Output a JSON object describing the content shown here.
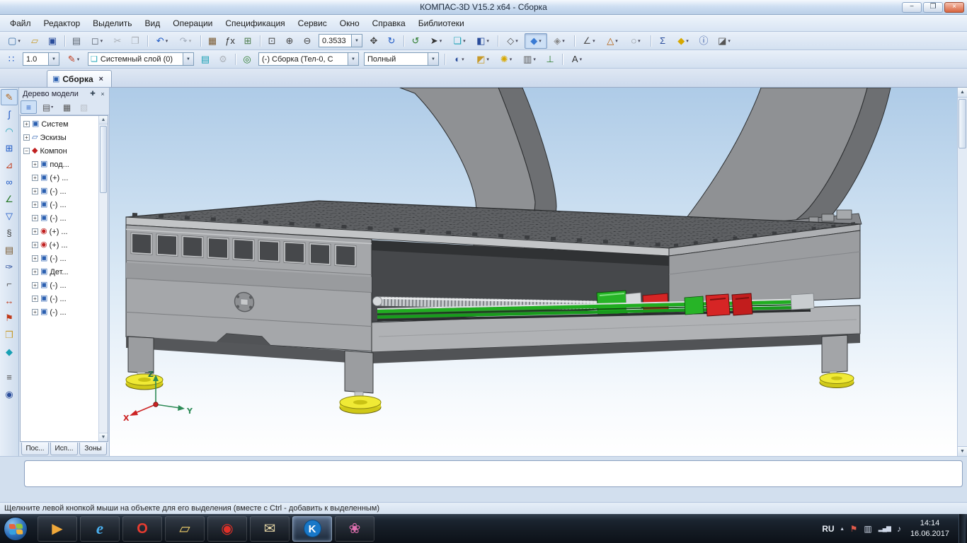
{
  "window": {
    "title": "КОМПАС-3D V15.2 x64 - Сборка",
    "minimize": "−",
    "restore": "❐",
    "close": "×"
  },
  "menu": {
    "items": [
      {
        "name": "menu-file",
        "label": "Файл"
      },
      {
        "name": "menu-editor",
        "label": "Редактор"
      },
      {
        "name": "menu-select",
        "label": "Выделить"
      },
      {
        "name": "menu-view",
        "label": "Вид"
      },
      {
        "name": "menu-operations",
        "label": "Операции"
      },
      {
        "name": "menu-specification",
        "label": "Спецификация"
      },
      {
        "name": "menu-service",
        "label": "Сервис"
      },
      {
        "name": "menu-window",
        "label": "Окно"
      },
      {
        "name": "menu-help",
        "label": "Справка"
      },
      {
        "name": "menu-libraries",
        "label": "Библиотеки"
      }
    ]
  },
  "toolbar1": {
    "zoom": {
      "value": "0.3533"
    },
    "buttons_a": [
      {
        "name": "new-document-button",
        "icon": "new-document-icon",
        "glyph": "▢",
        "color": "#3a6ea5",
        "cls": "dd"
      },
      {
        "name": "open-button",
        "icon": "open-folder-icon",
        "glyph": "▱",
        "color": "#c79a2a",
        "cls": ""
      },
      {
        "name": "save-button",
        "icon": "save-icon",
        "glyph": "▣",
        "color": "#2a4d9b",
        "cls": ""
      },
      {
        "name": "print-button",
        "icon": "printer-icon",
        "glyph": "▤",
        "color": "#5a6470",
        "cls": "sep"
      },
      {
        "name": "preview-button",
        "icon": "preview-icon",
        "glyph": "◻",
        "color": "#5a6470",
        "cls": "dd"
      },
      {
        "name": "cut-button",
        "icon": "scissors-icon",
        "glyph": "✂",
        "color": "#555555",
        "cls": "disabled"
      },
      {
        "name": "copy-button",
        "icon": "copy-icon",
        "glyph": "❐",
        "color": "#555555",
        "cls": "disabled"
      },
      {
        "name": "undo-button",
        "icon": "undo-icon",
        "glyph": "↶",
        "color": "#1a56c4",
        "cls": "sep dd"
      },
      {
        "name": "redo-button",
        "icon": "redo-icon",
        "glyph": "↷",
        "color": "#1a56c4",
        "cls": "dd disabled"
      },
      {
        "name": "library-manager-button",
        "icon": "library-icon",
        "glyph": "▦",
        "color": "#7a5a30",
        "cls": "sep"
      },
      {
        "name": "variables-button",
        "icon": "fx-icon",
        "glyph": "ƒx",
        "color": "#333333",
        "cls": ""
      },
      {
        "name": "spreadsheet-button",
        "icon": "table-icon",
        "glyph": "⊞",
        "color": "#4a7a4a",
        "cls": ""
      },
      {
        "name": "zoom-area-button",
        "icon": "zoom-area-icon",
        "glyph": "⊡",
        "color": "#444444",
        "cls": "sep"
      },
      {
        "name": "zoom-in-button",
        "icon": "zoom-in-icon",
        "glyph": "⊕",
        "color": "#444444",
        "cls": ""
      },
      {
        "name": "zoom-out-button",
        "icon": "zoom-out-icon",
        "glyph": "⊖",
        "color": "#444444",
        "cls": ""
      }
    ],
    "buttons_b": [
      {
        "name": "pan-button",
        "icon": "pan-icon",
        "glyph": "✥",
        "color": "#444444",
        "cls": ""
      },
      {
        "name": "rotate-button",
        "icon": "orbit-icon",
        "glyph": "↻",
        "color": "#1a56c4",
        "cls": ""
      },
      {
        "name": "refresh-button",
        "icon": "refresh-icon",
        "glyph": "↺",
        "color": "#2a7a2a",
        "cls": "sep"
      },
      {
        "name": "selection-filter-button",
        "icon": "cursor-icon",
        "glyph": "➤",
        "color": "#333333",
        "cls": "dd"
      },
      {
        "name": "layers-button",
        "icon": "layers-icon",
        "glyph": "❏",
        "color": "#18a0b4",
        "cls": "dd"
      },
      {
        "name": "orientation-button",
        "icon": "orientation-cube-icon",
        "glyph": "◧",
        "color": "#2a4d9b",
        "cls": "dd"
      },
      {
        "name": "wireframe-button",
        "icon": "wireframe-cube-icon",
        "glyph": "◇",
        "color": "#555555",
        "cls": "sep dd"
      },
      {
        "name": "shaded-button",
        "icon": "shaded-cube-icon",
        "glyph": "◆",
        "color": "#3a7bd4",
        "cls": "dd active"
      },
      {
        "name": "simplified-button",
        "icon": "simplified-cube-icon",
        "glyph": "◈",
        "color": "#888888",
        "cls": "dd"
      },
      {
        "name": "measure-button",
        "icon": "measure-icon",
        "glyph": "∠",
        "color": "#555555",
        "cls": "sep dd"
      },
      {
        "name": "check-collisions-button",
        "icon": "collision-icon",
        "glyph": "△",
        "color": "#b35900",
        "cls": "dd"
      },
      {
        "name": "hide-components-button",
        "icon": "hide-icon",
        "glyph": "◌",
        "color": "#555555",
        "cls": "dd"
      },
      {
        "name": "mass-properties-button",
        "icon": "scales-icon",
        "glyph": "Σ",
        "color": "#2a4d9b",
        "cls": "sep"
      },
      {
        "name": "component-button",
        "icon": "component-cube-icon",
        "glyph": "◆",
        "color": "#d7a800",
        "cls": "dd"
      },
      {
        "name": "info-button",
        "icon": "info-icon",
        "glyph": "ⓘ",
        "color": "#2a4d9b",
        "cls": ""
      },
      {
        "name": "section-view-button",
        "icon": "section-icon",
        "glyph": "◪",
        "color": "#555555",
        "cls": "dd"
      }
    ]
  },
  "toolbar2": {
    "line_width": "1.0",
    "layer": "Системный слой (0)",
    "layer_icon": "❏",
    "assembly": "(-) Сборка (Тел-0, С",
    "display_mode": "Полный",
    "g1": [
      {
        "name": "snap-button",
        "icon": "grid-snap-icon",
        "glyph": "∷",
        "color": "#1a56c4",
        "cls": ""
      }
    ],
    "g2": [
      {
        "name": "line-style-button",
        "icon": "pencil-icon",
        "glyph": "✎",
        "color": "#c03a1a",
        "cls": "dd"
      }
    ],
    "g3": [
      {
        "name": "layers-manager-button",
        "icon": "layers-manager-icon",
        "glyph": "▤",
        "color": "#18a0b4",
        "cls": ""
      },
      {
        "name": "layer-settings-button",
        "icon": "gear-icon",
        "glyph": "⚙",
        "color": "#666666",
        "cls": "disabled"
      }
    ],
    "g4": [
      {
        "name": "edit-scope-button",
        "icon": "scope-icon",
        "glyph": "◎",
        "color": "#2a7a2a",
        "cls": "sep"
      }
    ],
    "g5": [
      {
        "name": "appearance-button",
        "icon": "sphere-icon",
        "glyph": "◐",
        "color": "#2a4d9b",
        "cls": "sep dd"
      },
      {
        "name": "perspective-button",
        "icon": "perspective-icon",
        "glyph": "◩",
        "color": "#c79a2a",
        "cls": "dd"
      },
      {
        "name": "lights-button",
        "icon": "light-icon",
        "glyph": "✺",
        "color": "#d7a800",
        "cls": "dd"
      },
      {
        "name": "clip-plane-button",
        "icon": "clip-plane-icon",
        "glyph": "▥",
        "color": "#555555",
        "cls": "dd"
      },
      {
        "name": "origin-axes-button",
        "icon": "axes-icon",
        "glyph": "⊥",
        "color": "#2a7a2a",
        "cls": ""
      },
      {
        "name": "spell-check-button",
        "icon": "spellcheck-icon",
        "glyph": "А",
        "color": "#333333",
        "cls": "sep dd"
      }
    ]
  },
  "doc_tab": {
    "icon": "▣",
    "label": "Сборка",
    "close": "×"
  },
  "compact_panel": {
    "items": [
      {
        "name": "edit-assembly-panel-button",
        "icon": "pencil-cube-icon",
        "glyph": "✎",
        "color": "#b3651a",
        "cls": "active"
      },
      {
        "name": "spatial-curves-panel-button",
        "icon": "curve-icon",
        "glyph": "∫",
        "color": "#1a56c4",
        "cls": ""
      },
      {
        "name": "surfaces-panel-button",
        "icon": "surface-icon",
        "glyph": "◠",
        "color": "#18a0b4",
        "cls": ""
      },
      {
        "name": "arrays-panel-button",
        "icon": "array-icon",
        "glyph": "⊞",
        "color": "#1a56c4",
        "cls": ""
      },
      {
        "name": "aux-geometry-panel-button",
        "icon": "aux-geometry-icon",
        "glyph": "⊿",
        "color": "#c03a1a",
        "cls": ""
      },
      {
        "name": "mates-panel-button",
        "icon": "mate-icon",
        "glyph": "∞",
        "color": "#1a56c4",
        "cls": ""
      },
      {
        "name": "measure3d-panel-button",
        "icon": "angle-icon",
        "glyph": "∠",
        "color": "#2a7a2a",
        "cls": ""
      },
      {
        "name": "filters-panel-button",
        "icon": "filter-icon",
        "glyph": "▽",
        "color": "#1a56c4",
        "cls": ""
      },
      {
        "name": "specification-panel-button",
        "icon": "spec-icon",
        "glyph": "§",
        "color": "#444444",
        "cls": ""
      },
      {
        "name": "reports-panel-button",
        "icon": "report-icon",
        "glyph": "▤",
        "color": "#7a5a30",
        "cls": ""
      },
      {
        "name": "decor-elements-panel-button",
        "icon": "decor-pen-icon",
        "glyph": "✑",
        "color": "#2a4d9b",
        "cls": ""
      },
      {
        "name": "sheet-metal-panel-button",
        "icon": "sheet-metal-icon",
        "glyph": "⌐",
        "color": "#555555",
        "cls": ""
      },
      {
        "name": "dimensions-panel-button",
        "icon": "dimension-icon",
        "glyph": "↔",
        "color": "#c03a1a",
        "cls": ""
      },
      {
        "name": "designations-panel-button",
        "icon": "designation-flag-icon",
        "glyph": "⚑",
        "color": "#c03a1a",
        "cls": ""
      },
      {
        "name": "parts-library-panel-button",
        "icon": "parts-library-icon",
        "glyph": "❒",
        "color": "#c79a2a",
        "cls": ""
      },
      {
        "name": "macro-panel-button",
        "icon": "macro-icon",
        "glyph": "◆",
        "color": "#18a0b4",
        "cls": ""
      },
      {
        "name": "properties-panel-button",
        "icon": "properties-icon",
        "glyph": "≡",
        "color": "#555555",
        "cls": "gap"
      },
      {
        "name": "search-panel-button",
        "icon": "search-icon",
        "glyph": "◉",
        "color": "#2a4d9b",
        "cls": ""
      }
    ]
  },
  "tree": {
    "title": "Дерево модели",
    "pin": "✚",
    "close": "×",
    "toolbar": [
      {
        "name": "tree-structure-button",
        "icon": "tree-icon",
        "glyph": "≡",
        "color": "#1a56c4",
        "cls": "active"
      },
      {
        "name": "tree-sections-button",
        "icon": "sections-icon",
        "glyph": "▤",
        "color": "#555555",
        "cls": "dd"
      },
      {
        "name": "tree-composition-button",
        "icon": "composition-icon",
        "glyph": "▦",
        "color": "#555555",
        "cls": ""
      },
      {
        "name": "tree-relations-button",
        "icon": "relations-icon",
        "glyph": "▧",
        "color": "#888888",
        "cls": "disabled"
      }
    ],
    "items": [
      {
        "exp": "+",
        "glyph": "▣",
        "color": "#2a5fb0",
        "label": "Систем",
        "cls": ""
      },
      {
        "exp": "+",
        "glyph": "▱",
        "color": "#2a5fb0",
        "label": "Эскизы",
        "cls": ""
      },
      {
        "exp": "−",
        "glyph": "◆",
        "color": "#c02020",
        "label": "Компон",
        "cls": ""
      },
      {
        "exp": "+",
        "glyph": "▣",
        "color": "#2a5fb0",
        "label": "под...",
        "cls": "ind"
      },
      {
        "exp": "+",
        "glyph": "▣",
        "color": "#2a5fb0",
        "label": "(+) ...",
        "cls": "ind"
      },
      {
        "exp": "+",
        "glyph": "▣",
        "color": "#2a5fb0",
        "label": "(-) ...",
        "cls": "ind"
      },
      {
        "exp": "+",
        "glyph": "▣",
        "color": "#2a5fb0",
        "label": "(-) ...",
        "cls": "ind"
      },
      {
        "exp": "+",
        "glyph": "▣",
        "color": "#2a5fb0",
        "label": "(-) ...",
        "cls": "ind"
      },
      {
        "exp": "+",
        "glyph": "◉",
        "color": "#c02020",
        "label": "(+) ...",
        "cls": "ind"
      },
      {
        "exp": "+",
        "glyph": "◉",
        "color": "#c02020",
        "label": "(+) ...",
        "cls": "ind"
      },
      {
        "exp": "+",
        "glyph": "▣",
        "color": "#2a5fb0",
        "label": "(-) ...",
        "cls": "ind"
      },
      {
        "exp": "+",
        "glyph": "▣",
        "color": "#2a5fb0",
        "label": "Дет...",
        "cls": "ind"
      },
      {
        "exp": "+",
        "glyph": "▣",
        "color": "#2a5fb0",
        "label": "(-) ...",
        "cls": "ind"
      },
      {
        "exp": "+",
        "glyph": "▣",
        "color": "#2a5fb0",
        "label": "(-) ...",
        "cls": "ind"
      },
      {
        "exp": "+",
        "glyph": "▣",
        "color": "#2a5fb0",
        "label": "(-) ...",
        "cls": "ind"
      }
    ],
    "tabs": [
      {
        "name": "tree-tab-pos",
        "label": "Пос..."
      },
      {
        "name": "tree-tab-isp",
        "label": "Исп..."
      },
      {
        "name": "tree-tab-zones",
        "label": "Зоны"
      }
    ]
  },
  "viewport": {
    "axes": {
      "x": "X",
      "y": "Y",
      "z": "Z"
    }
  },
  "statusbar": {
    "hint": "Щелкните левой кнопкой мыши на объекте для его выделения (вместе с Ctrl - добавить к выделенным)"
  },
  "taskbar": {
    "buttons": [
      {
        "name": "taskbar-media-button",
        "icon": "media-player-icon",
        "glyph": "▶",
        "color": "#f0a83a",
        "cls": ""
      },
      {
        "name": "taskbar-ie-button",
        "icon": "internet-explorer-icon",
        "glyph": "e",
        "color": "#4ab0f0",
        "cls": "it"
      },
      {
        "name": "taskbar-opera-button",
        "icon": "opera-icon",
        "glyph": "O",
        "color": "#e83c30",
        "cls": "bold"
      },
      {
        "name": "taskbar-explorer-button",
        "icon": "folder-icon",
        "glyph": "▱",
        "color": "#f0cf6a",
        "cls": ""
      },
      {
        "name": "taskbar-abbyy-button",
        "icon": "red-circle-icon",
        "glyph": "◉",
        "color": "#e03028",
        "cls": ""
      },
      {
        "name": "taskbar-mail-button",
        "icon": "mail-icon",
        "glyph": "✉",
        "color": "#e8d9a8",
        "cls": ""
      },
      {
        "name": "taskbar-kompas-button",
        "icon": "kompas-icon",
        "glyph": "K",
        "color": "#ffffff",
        "cls": "active kompas"
      },
      {
        "name": "taskbar-graphics-button",
        "icon": "palette-icon",
        "glyph": "❀",
        "color": "#e070b0",
        "cls": ""
      }
    ],
    "tray": {
      "lang": "RU",
      "hidden_arrow": "▴",
      "icons": [
        {
          "name": "tray-flag-icon",
          "glyph": "⚑",
          "color": "#e05a4a"
        },
        {
          "name": "tray-display-icon",
          "glyph": "▥",
          "color": "#cfd8e8"
        },
        {
          "name": "tray-network-icon",
          "glyph": "▂▄▆",
          "color": "#cfd8e8",
          "cls": "bars"
        },
        {
          "name": "tray-volume-icon",
          "glyph": "♪",
          "color": "#cfd8e8"
        }
      ],
      "time": "14:14",
      "date": "16.06.2017"
    }
  }
}
